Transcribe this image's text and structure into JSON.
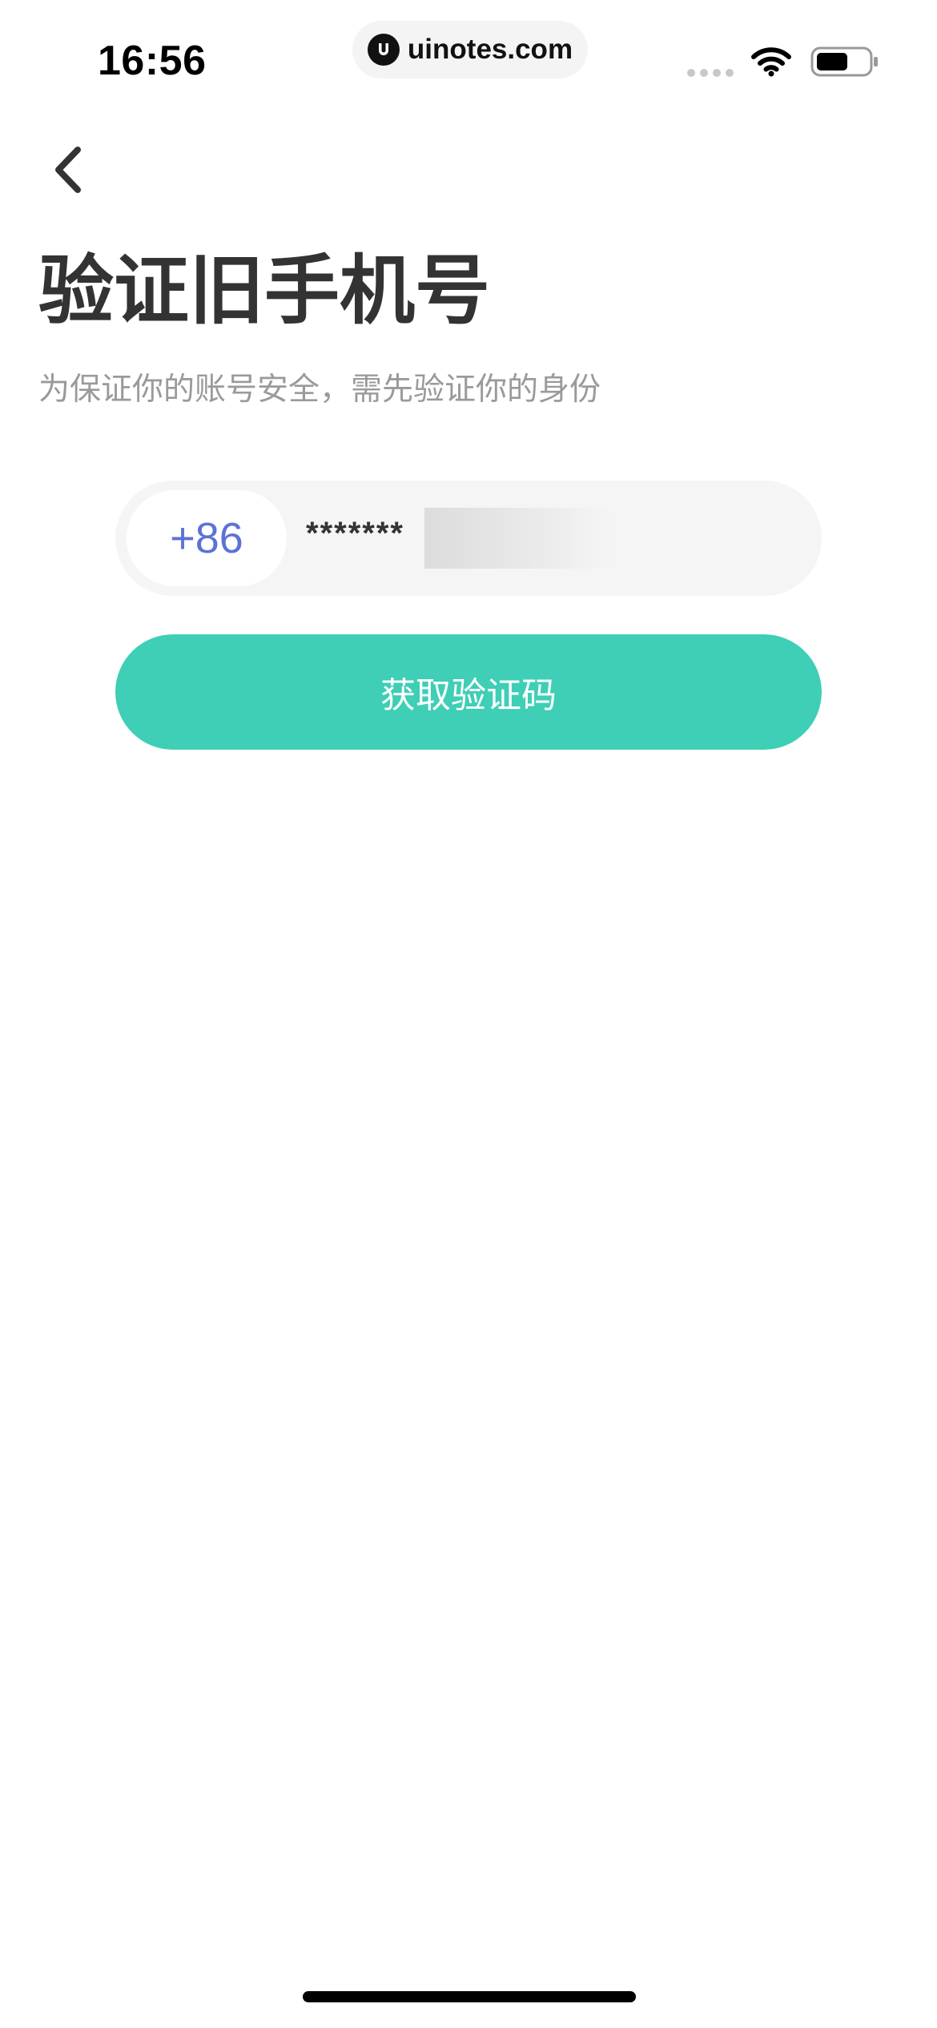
{
  "status_bar": {
    "time": "16:56",
    "url": "uinotes.com",
    "icons": [
      "signal-icon",
      "wifi-icon",
      "battery-icon"
    ]
  },
  "navigation": {
    "back_icon": "chevron-left-icon"
  },
  "header": {
    "title": "验证旧手机号",
    "subtitle": "为保证你的账号安全，需先验证你的身份"
  },
  "phone_input": {
    "country_code": "+86",
    "value": "*******"
  },
  "actions": {
    "get_code_label": "获取验证码"
  },
  "colors": {
    "accent": "#3ecfb6",
    "country_code": "#5b72d5",
    "title": "#333333",
    "subtitle": "#9a9a9a",
    "field_bg": "#f5f5f5"
  }
}
